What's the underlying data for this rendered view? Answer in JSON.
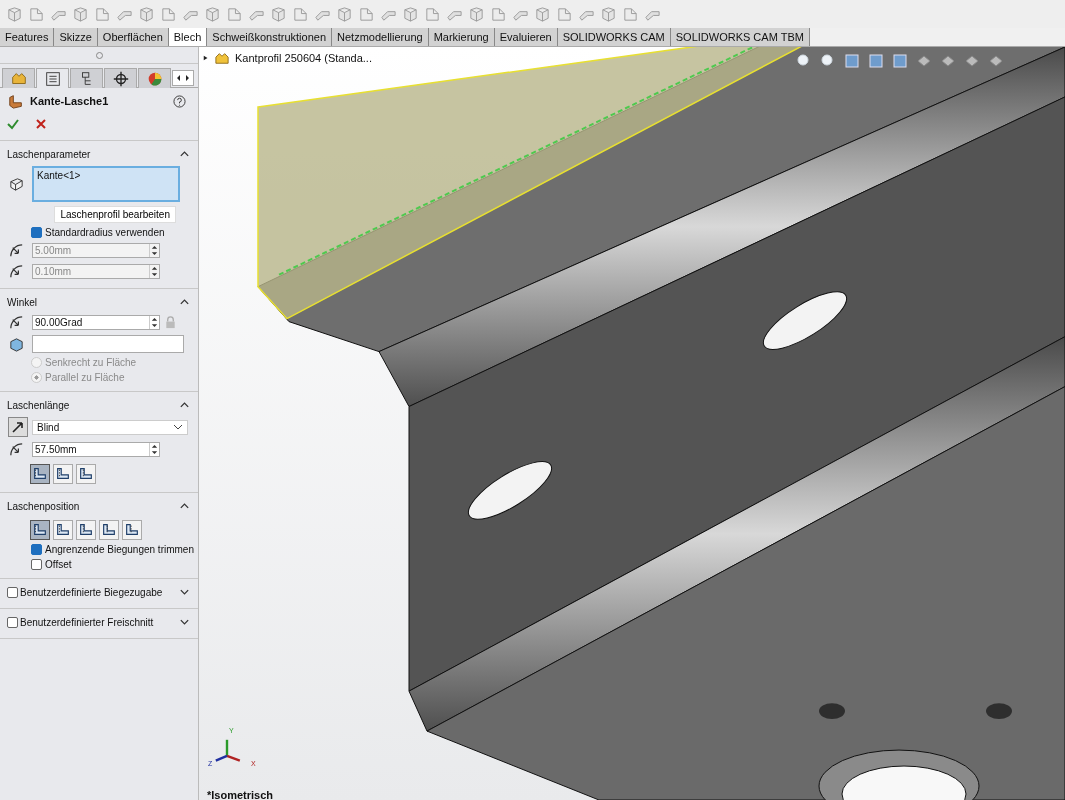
{
  "command_tabs": [
    {
      "label": "Features",
      "selected": false
    },
    {
      "label": "Skizze",
      "selected": false
    },
    {
      "label": "Oberflächen",
      "selected": false
    },
    {
      "label": "Blech",
      "selected": true
    },
    {
      "label": "Schweißkonstruktionen",
      "selected": false
    },
    {
      "label": "Netzmodellierung",
      "selected": false
    },
    {
      "label": "Markierung",
      "selected": false
    },
    {
      "label": "Evaluieren",
      "selected": false
    },
    {
      "label": "SOLIDWORKS CAM",
      "selected": false
    },
    {
      "label": "SOLIDWORKS CAM TBM",
      "selected": false
    }
  ],
  "manager_tabs": [
    {
      "selected": false
    },
    {
      "selected": true
    },
    {
      "selected": false
    },
    {
      "selected": false
    },
    {
      "selected": false
    }
  ],
  "property_manager": {
    "title": "Kante-Lasche1",
    "sections": [
      {
        "title": "Laschenparameter",
        "expanded": true,
        "rows": [
          {
            "kind": "selection",
            "value": "Kante<1>"
          },
          {
            "kind": "button",
            "label": "Laschenprofil bearbeiten"
          },
          {
            "kind": "checkbox",
            "label": "Standardradius verwenden",
            "checked": true
          },
          {
            "kind": "spin",
            "value": "5.00mm",
            "disabled": true
          },
          {
            "kind": "spin",
            "value": "0.10mm",
            "disabled": true
          }
        ]
      },
      {
        "title": "Winkel",
        "expanded": true,
        "rows": [
          {
            "kind": "spin",
            "value": "90.00Grad",
            "disabled": false,
            "lock": true
          },
          {
            "kind": "text"
          },
          {
            "kind": "radio",
            "label": "Senkrecht zu Fläche",
            "selected": false,
            "disabled": true
          },
          {
            "kind": "radio",
            "label": "Parallel zu Fläche",
            "selected": true,
            "disabled": true
          }
        ]
      },
      {
        "title": "Laschenlänge",
        "expanded": true,
        "rows": [
          {
            "kind": "dropdown",
            "value": "Blind"
          },
          {
            "kind": "spin",
            "value": "57.50mm",
            "disabled": false
          },
          {
            "kind": "icon_buttons",
            "items": [
              {
                "selected": true
              },
              {
                "selected": false
              },
              {
                "selected": false
              }
            ]
          }
        ]
      },
      {
        "title": "Laschenposition",
        "expanded": true,
        "rows": [
          {
            "kind": "icon_buttons",
            "items": [
              {
                "selected": true
              },
              {
                "selected": false
              },
              {
                "selected": false
              },
              {
                "selected": false
              },
              {
                "selected": false
              }
            ]
          },
          {
            "kind": "checkbox",
            "label": "Angrenzende Biegungen trimmen",
            "checked": true
          },
          {
            "kind": "checkbox",
            "label": "Offset",
            "checked": false
          }
        ]
      },
      {
        "title": "Benutzerdefinierte Biegezugabe",
        "expanded": false,
        "checked": false
      },
      {
        "title": "Benutzerdefinierter Freischnitt",
        "expanded": false,
        "checked": false
      }
    ]
  },
  "viewport": {
    "tree_item": "Kantprofil 250604 (Standa...",
    "triad": {
      "x": "X",
      "y": "Y",
      "z": "Z"
    },
    "view_name": "*Isometrisch"
  }
}
